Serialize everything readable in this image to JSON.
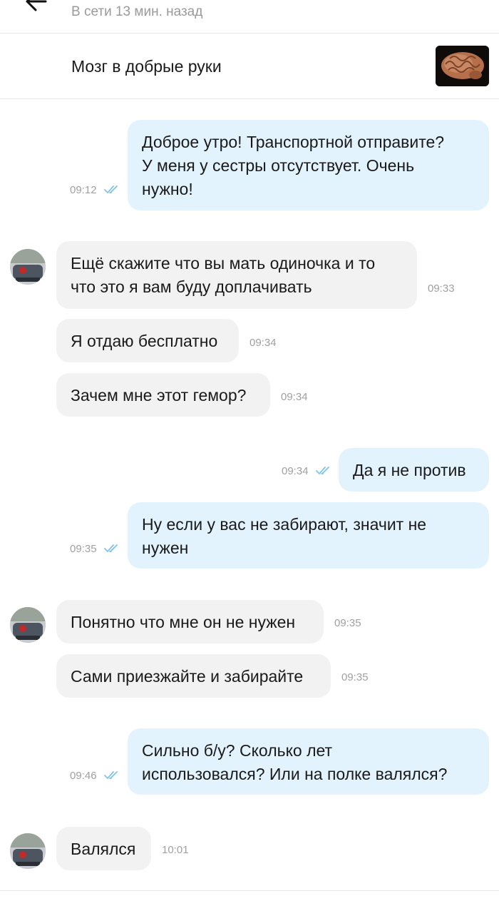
{
  "header": {
    "status": "В сети 13 мин. назад"
  },
  "listing": {
    "title": "Мозг в добрые руки"
  },
  "messages": [
    {
      "dir": "out",
      "text": "Доброе утро! Транспортной отправите?\nУ меня у сестры отсутствует. Очень\nнужно!",
      "time": "09:12",
      "read": true
    },
    {
      "dir": "in",
      "text": "Ещё скажите что вы мать одиночка и то\nчто это я вам буду доплачивать",
      "time": "09:33"
    },
    {
      "dir": "in",
      "text": "Я отдаю бесплатно",
      "time": "09:34"
    },
    {
      "dir": "in",
      "text": "Зачем мне этот гемор?",
      "time": "09:34"
    },
    {
      "dir": "out",
      "text": "Да я не против",
      "time": "09:34",
      "read": true
    },
    {
      "dir": "out",
      "text": "Ну если у вас не забирают, значит не\nнужен",
      "time": "09:35",
      "read": true
    },
    {
      "dir": "in",
      "text": "Понятно что мне он не нужен",
      "time": "09:35"
    },
    {
      "dir": "in",
      "text": "Сами приезжайте и забирайте",
      "time": "09:35"
    },
    {
      "dir": "out",
      "text": "Сильно б/у? Сколько лет\nиспользовался? Или на полке валялся?",
      "time": "09:46",
      "read": true
    },
    {
      "dir": "in",
      "text": "Валялся",
      "time": "10:01"
    }
  ],
  "colors": {
    "incoming_bubble": "#f2f2f2",
    "outgoing_bubble": "#e3f3fd",
    "read_ticks": "#7fc3ec",
    "timestamp": "#a0a0a0"
  },
  "icons": {
    "back": "arrow-left-icon",
    "read": "double-check-icon",
    "avatar": "user-avatar",
    "listing_image": "brain-image"
  }
}
